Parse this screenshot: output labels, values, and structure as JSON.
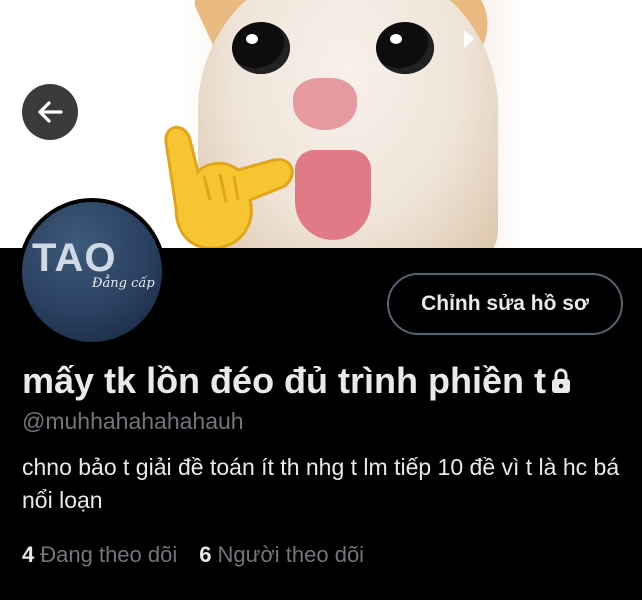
{
  "profile": {
    "name": "mấy tk lồn đéo đủ trình phiền t",
    "handle": "@muhhahahahahauh",
    "bio": "chno bảo t giải đề toán ít th nhg t lm tiếp 10 đề vì t là hc bá nổi loạn",
    "edit_label": "Chỉnh sửa hồ sơ",
    "avatar_logo": "TAO",
    "avatar_subtext": "Đẳng cấp",
    "following_count": "4",
    "following_label": "Đang theo dõi",
    "followers_count": "6",
    "followers_label": "Người theo dõi"
  },
  "icons": {
    "back": "arrow-left-icon",
    "lock": "lock-icon"
  },
  "colors": {
    "background": "#000000",
    "text_primary": "#e7e9ea",
    "text_secondary": "#71767b",
    "border": "#536471"
  }
}
